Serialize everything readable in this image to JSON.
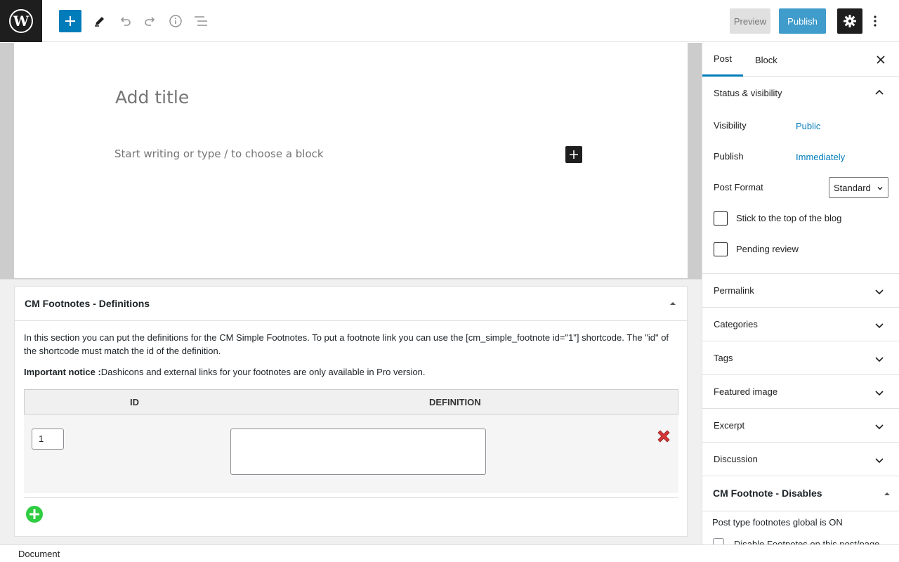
{
  "toolbar": {
    "preview_label": "Preview",
    "publish_label": "Publish"
  },
  "editor": {
    "title_placeholder": "Add title",
    "body_placeholder": "Start writing or type / to choose a block"
  },
  "metabox": {
    "title": "CM Footnotes - Definitions",
    "description": "In this section you can put the definitions for the CM Simple Footnotes. To put a footnote link you can use the [cm_simple_footnote id=\"1\"] shortcode. The \"id\" of the shortcode must match the id of the definition.",
    "notice_label": "Important notice :",
    "notice_text": "Dashicons and external links for your footnotes are only available in Pro version.",
    "columns": [
      "ID",
      "DEFINITION"
    ],
    "rows": [
      {
        "id": "1",
        "definition": ""
      }
    ]
  },
  "sidebar": {
    "tabs": [
      "Post",
      "Block"
    ],
    "status_panel": {
      "title": "Status & visibility",
      "visibility_label": "Visibility",
      "visibility_value": "Public",
      "publish_label": "Publish",
      "publish_value": "Immediately",
      "format_label": "Post Format",
      "format_value": "Standard",
      "sticky_label": "Stick to the top of the blog",
      "pending_label": "Pending review"
    },
    "panels": [
      "Permalink",
      "Categories",
      "Tags",
      "Featured image",
      "Excerpt",
      "Discussion"
    ],
    "cm_panel": {
      "title": "CM Footnote - Disables",
      "status_text": "Post type footnotes global is ON",
      "checkbox_label": "Disable Footnotes on this post/page"
    }
  },
  "footer": {
    "breadcrumb": "Document"
  },
  "colors": {
    "accent": "#007cba",
    "dark": "#1e1e1e",
    "add_green": "#2ecc40",
    "delete_red": "#d63638"
  }
}
